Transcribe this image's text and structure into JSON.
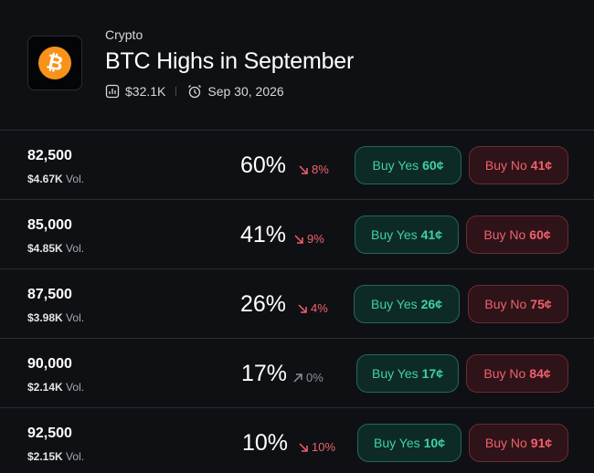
{
  "header": {
    "category": "Crypto",
    "title": "BTC Highs in September",
    "volume": "$32.1K",
    "end_date": "Sep 30, 2026",
    "logo_icon": "bitcoin-icon",
    "logo_symbol": "₿",
    "logo_color": "#f7931a"
  },
  "colors": {
    "yes": "#3ed1a9",
    "no": "#f0616d",
    "background": "#0f1013"
  },
  "markets": [
    {
      "label": "82,500",
      "volume": "$4.67K",
      "volume_suffix": "Vol.",
      "chance": "60%",
      "change": "8%",
      "change_dir": "down",
      "yes_label": "Buy Yes",
      "yes_price": "60¢",
      "no_label": "Buy No",
      "no_price": "41¢"
    },
    {
      "label": "85,000",
      "volume": "$4.85K",
      "volume_suffix": "Vol.",
      "chance": "41%",
      "change": "9%",
      "change_dir": "down",
      "yes_label": "Buy Yes",
      "yes_price": "41¢",
      "no_label": "Buy No",
      "no_price": "60¢"
    },
    {
      "label": "87,500",
      "volume": "$3.98K",
      "volume_suffix": "Vol.",
      "chance": "26%",
      "change": "4%",
      "change_dir": "down",
      "yes_label": "Buy Yes",
      "yes_price": "26¢",
      "no_label": "Buy No",
      "no_price": "75¢"
    },
    {
      "label": "90,000",
      "volume": "$2.14K",
      "volume_suffix": "Vol.",
      "chance": "17%",
      "change": "0%",
      "change_dir": "up",
      "yes_label": "Buy Yes",
      "yes_price": "17¢",
      "no_label": "Buy No",
      "no_price": "84¢"
    },
    {
      "label": "92,500",
      "volume": "$2.15K",
      "volume_suffix": "Vol.",
      "chance": "10%",
      "change": "10%",
      "change_dir": "down",
      "yes_label": "Buy Yes",
      "yes_price": "10¢",
      "no_label": "Buy No",
      "no_price": "91¢"
    }
  ]
}
